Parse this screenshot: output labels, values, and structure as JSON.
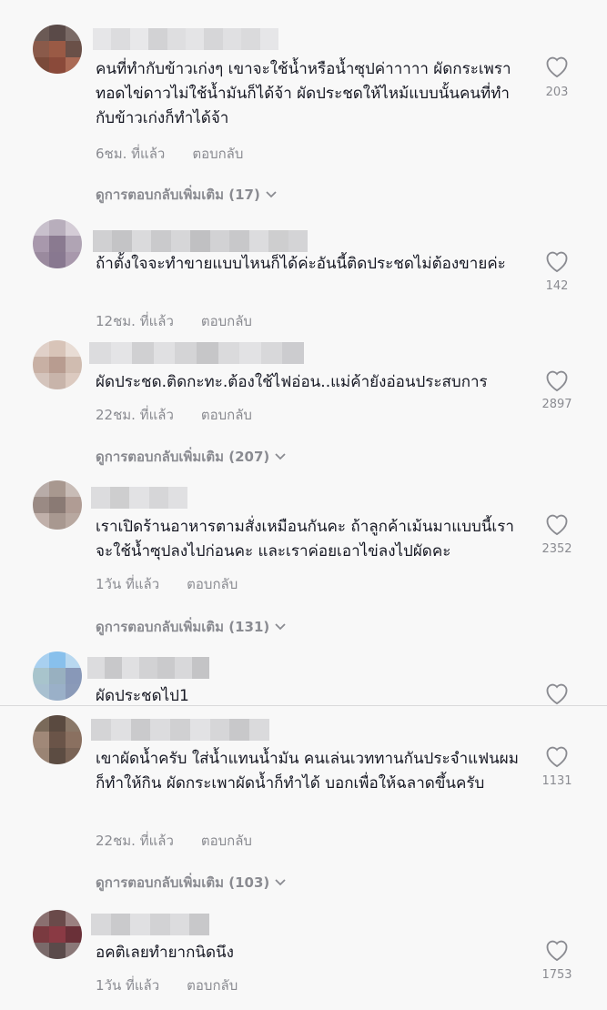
{
  "comments": [
    {
      "text": "คนที่ทำกับข้าวเก่งๆ เขาจะใช้น้ำหรือน้ำซุปค่าาาาา ผัดกระเพรา ทอดไข่ดาวไม่ใช้น้ำมันก็ได้จ้า ผัดประชดให้ไหม้แบบนั้นคนที่ทำกับข้าวเก่งก็ทำได้จ้า",
      "time": "6ชม. ที่แล้ว",
      "reply": "ตอบกลับ",
      "likes": "203",
      "more": "ดูการตอบกลับเพิ่มเติม (17)",
      "avatar_colors": [
        "#6b5a55",
        "#5a4a48",
        "#7a6a66",
        "#8a5a4a",
        "#9a5a45",
        "#6a5048",
        "#7a4a3a",
        "#8a4a3a",
        "#aa6a55"
      ],
      "name_colors": [
        "#e6e6e8",
        "#dcdcde",
        "#e8e8ea",
        "#d2d2d4",
        "#dedee0",
        "#e4e4e6",
        "#d6d6d8",
        "#e0e0e2",
        "#dadadc",
        "#e6e6e8"
      ]
    },
    {
      "text": "ถ้าตั้งใจจะทำขายแบบไหนก็ได้ค่ะอันนี้ติดประชดไม่ต้องขายค่ะ",
      "time": "12ชม. ที่แล้ว",
      "reply": "ตอบกลับ",
      "likes": "142",
      "more": "",
      "avatar_colors": [
        "#c8c0cc",
        "#b8aebc",
        "#d4ccd6",
        "#a898ac",
        "#8a7a90",
        "#b0a4b4",
        "#9a8a9e",
        "#887890",
        "#a898ac"
      ],
      "name_colors": [
        "#d0d0d2",
        "#c4c4c6",
        "#dadadc",
        "#cacacc",
        "#d6d6d8",
        "#c0c0c2",
        "#d2d2d4",
        "#c8c8ca",
        "#dcdcde",
        "#cececf",
        "#d4d4d6"
      ]
    },
    {
      "text": "ผัดประชด.ติดกะทะ.ต้องใช้ไฟอ่อน..แม่ค้ายังอ่อนประสบการ",
      "time": "22ชม. ที่แล้ว",
      "reply": "ตอบกลับ",
      "likes": "2897",
      "more": "ดูการตอบกลับเพิ่มเติม (207)",
      "avatar_colors": [
        "#e0d0c8",
        "#d8c4b8",
        "#e8dcd4",
        "#c8b0a4",
        "#b89c90",
        "#d0bcb0",
        "#d4c4bc",
        "#c8b4aa",
        "#dccac0"
      ],
      "name_colors": [
        "#dcdcde",
        "#e4e4e6",
        "#d0d0d2",
        "#e0e0e2",
        "#d4d4d6",
        "#c6c6c8",
        "#dadadc",
        "#e2e2e4",
        "#d8d8da",
        "#cccccf"
      ]
    },
    {
      "text": "เราเปิดร้านอาหารตามสั่งเหมือนกันคะ ถ้าลูกค้าเม้นมาแบบนี้เราจะใช้น้ำซุปลงไปก่อนคะ และเราค่อยเอาไข่ลงไปผัดคะ",
      "time": "1วัน ที่แล้ว",
      "reply": "ตอบกลับ",
      "likes": "2352",
      "more": "ดูการตอบกลับเพิ่มเติม (131)",
      "avatar_colors": [
        "#b8aca8",
        "#a8988f",
        "#c8bcb6",
        "#9a8a84",
        "#8a7a74",
        "#b09c94",
        "#c0b0aa",
        "#a89890",
        "#b8a8a0"
      ],
      "name_colors": [
        "#dcdcde",
        "#cececf",
        "#e2e2e4",
        "#d6d6d8",
        "#e0e0e2"
      ]
    },
    {
      "text": "ผัดประชดไป1",
      "time": "",
      "reply": "",
      "likes": "",
      "more": "",
      "avatar_colors": [
        "#a8d0f0",
        "#88c0ec",
        "#b8d8f0",
        "#a8c4cc",
        "#98b0c0",
        "#8898b8",
        "#a8c0d0",
        "#9ab0c8",
        "#8a9ab8"
      ],
      "name_colors": [
        "#dcdcde",
        "#c8c8ca",
        "#e0e0e2",
        "#d2d2d4",
        "#cacacc",
        "#d8d8da",
        "#c4c4c6"
      ]
    },
    {
      "text": "เขาผัดน้ำครับ ใส่น้ำแทนน้ำมัน คนเล่นเวททานกันประจำแฟนผมก็ทำให้กิน ผัดกระเพาผัดน้ำก็ทำได้ บอกเพื่อให้ฉลาดขึ้นครับ",
      "time": "22ชม. ที่แล้ว",
      "reply": "ตอบกลับ",
      "likes": "1131",
      "more": "ดูการตอบกลับเพิ่มเติม (103)",
      "avatar_colors": [
        "#7a6a5a",
        "#5a4a40",
        "#8a7868",
        "#a08878",
        "#6a5448",
        "#8a7060",
        "#9a8474",
        "#5c4c42",
        "#7a6456"
      ],
      "name_colors": [
        "#d4d4d6",
        "#e0e0e2",
        "#cacacc",
        "#dcdcde",
        "#d0d0d2",
        "#e2e2e4",
        "#d6d6d8",
        "#c8c8ca",
        "#dadadc"
      ]
    },
    {
      "text": "อคติเลยทำยากนิดนึง",
      "time": "1วัน ที่แล้ว",
      "reply": "ตอบกลับ",
      "likes": "1753",
      "more": "",
      "avatar_colors": [
        "#8a7070",
        "#6a4a4a",
        "#9a8080",
        "#7a3a40",
        "#8a3a44",
        "#6a3038",
        "#7a6a6a",
        "#5a4a4a",
        "#8a7878"
      ],
      "name_colors": [
        "#d8d8da",
        "#cacacc",
        "#e0e0e2",
        "#d2d2d4",
        "#dcdcde",
        "#c8c8ca"
      ]
    }
  ]
}
